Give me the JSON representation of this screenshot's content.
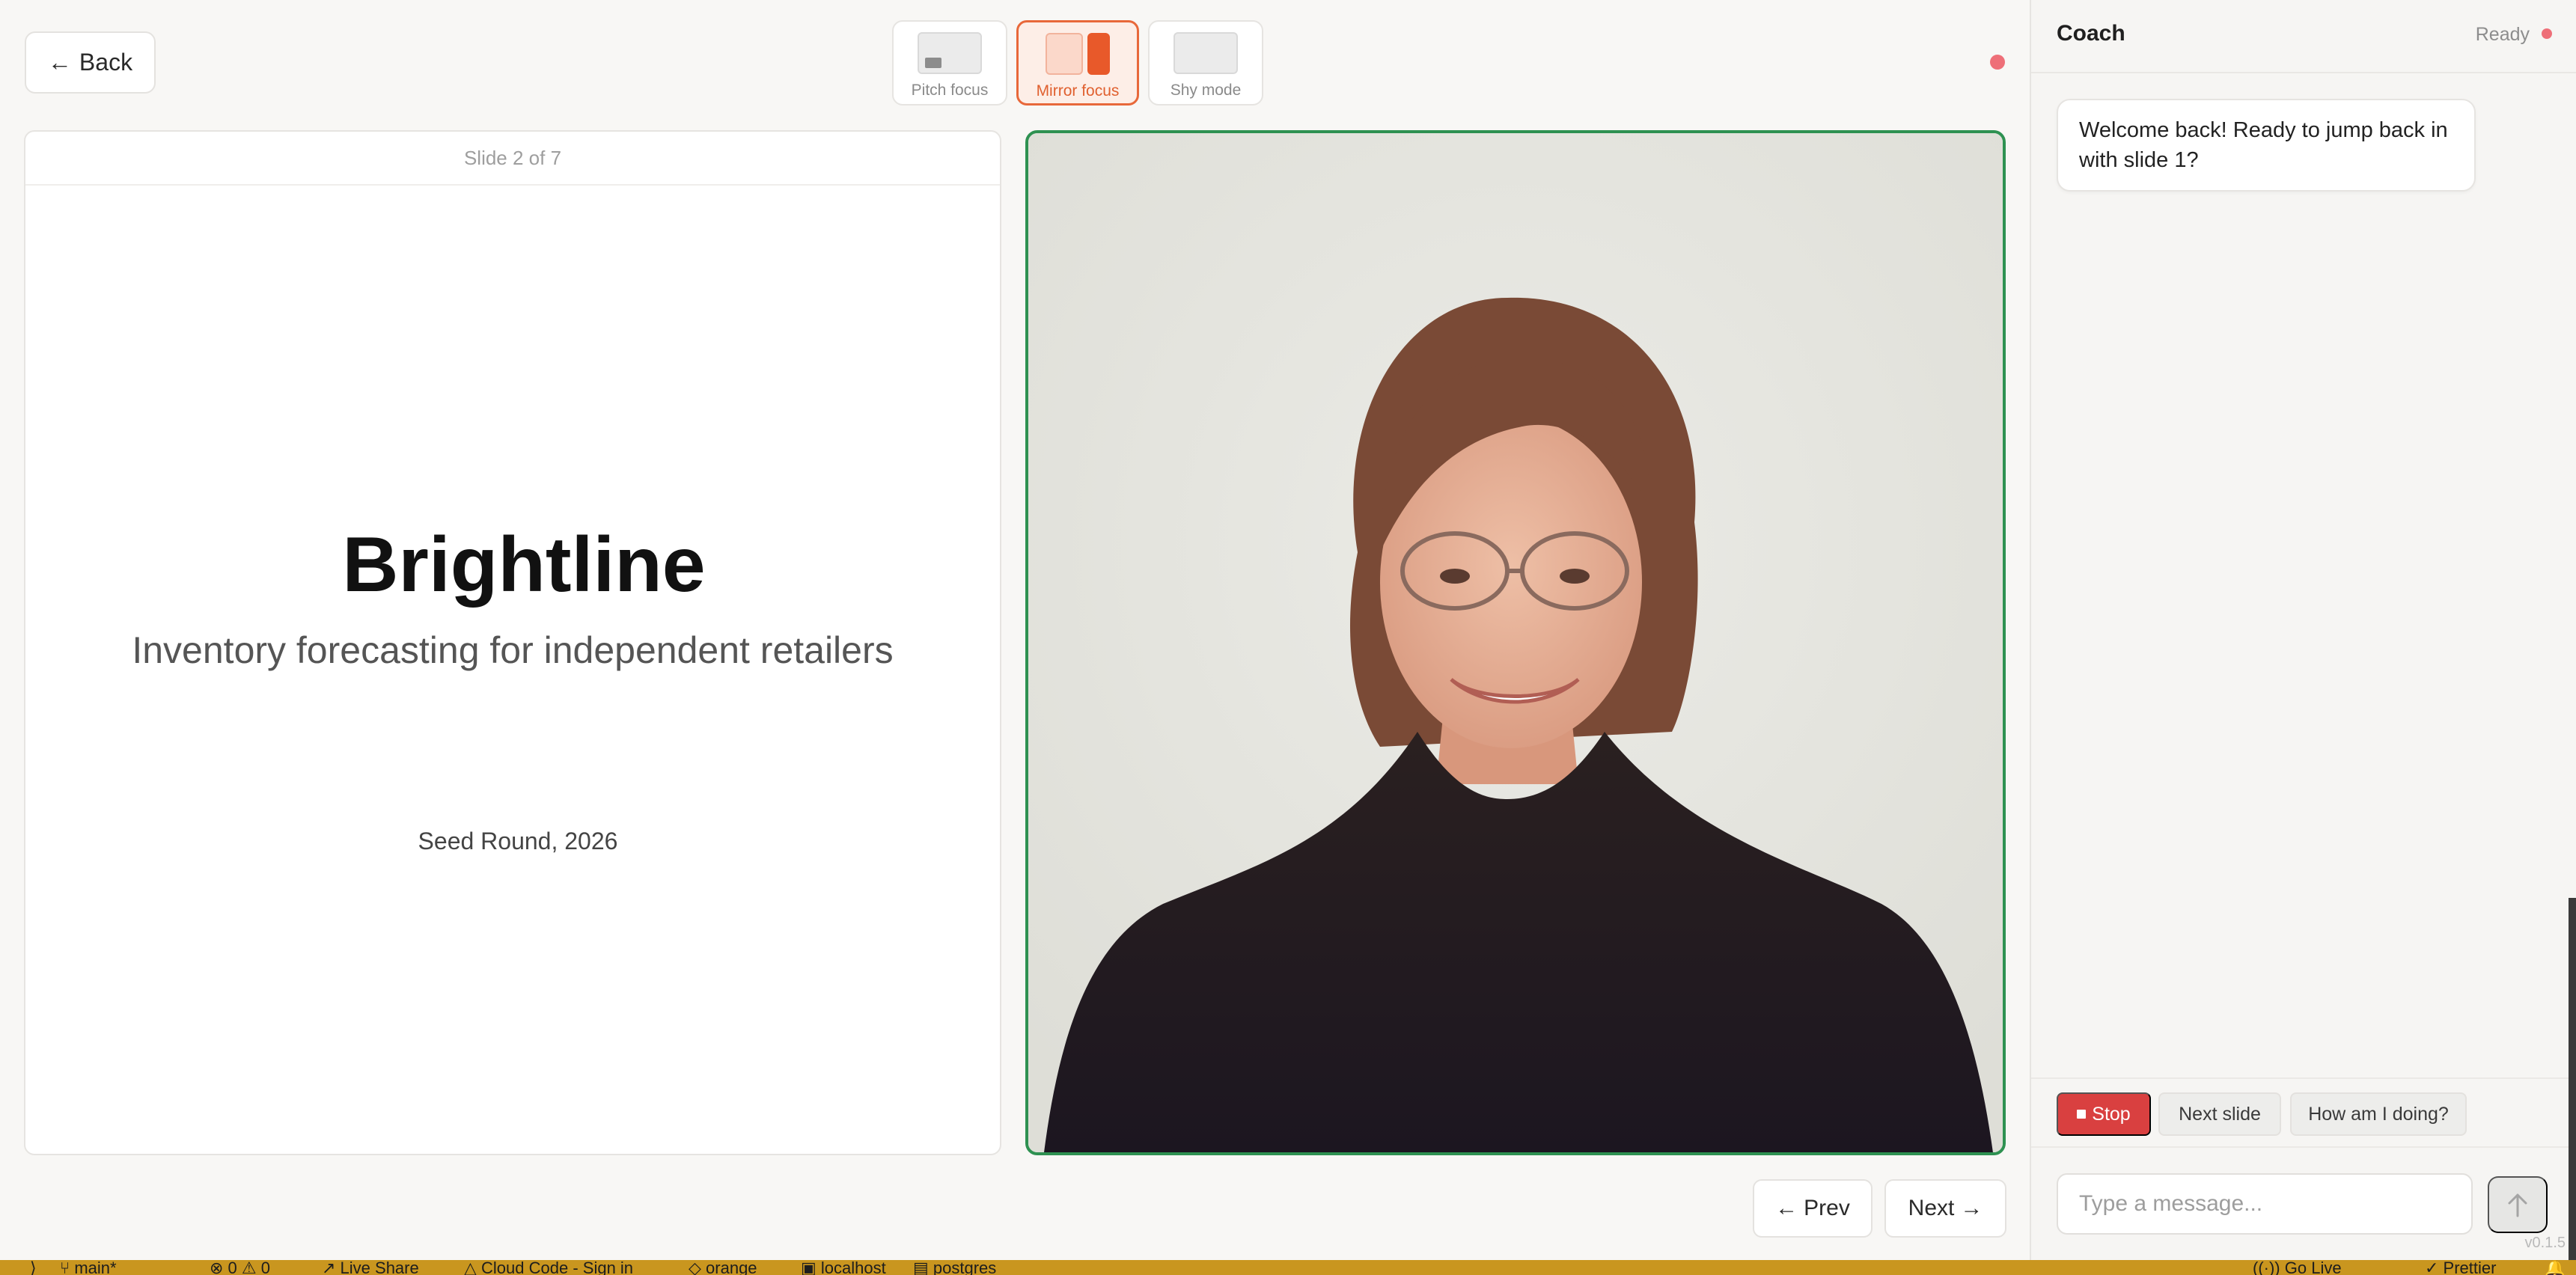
{
  "header": {
    "back_label": "Back",
    "modes": [
      {
        "label": "Pitch focus",
        "active": false
      },
      {
        "label": "Mirror focus",
        "active": true
      },
      {
        "label": "Shy mode",
        "active": false
      }
    ]
  },
  "slide": {
    "counter": "Slide 2 of 7",
    "title": "Brightline",
    "subtitle": "Inventory forecasting for independent retailers",
    "footer": "Seed Round, 2026"
  },
  "nav": {
    "prev_label": "Prev",
    "next_label": "Next"
  },
  "coach": {
    "title": "Coach",
    "status": "Ready",
    "message": "Welcome back! Ready to jump back in with slide 1?",
    "actions": {
      "stop": "Stop",
      "next_slide": "Next slide",
      "how_am_i": "How am I doing?"
    },
    "input_placeholder": "Type a message...",
    "version": "v0.1.5"
  },
  "statusbar": {
    "branch": "main*",
    "problems": "0 ⚠ 0",
    "live_share": "Live Share",
    "cloud_code": "Cloud Code - Sign in",
    "orange": "orange",
    "localhost": "localhost",
    "postgres": "postgres",
    "go_live": "Go Live",
    "prettier": "Prettier"
  },
  "colors": {
    "accent": "#e8683a",
    "camera_border": "#2e9151",
    "stop": "#d94040",
    "status_dot": "#ee6f78",
    "statusbar": "#c9961f"
  }
}
